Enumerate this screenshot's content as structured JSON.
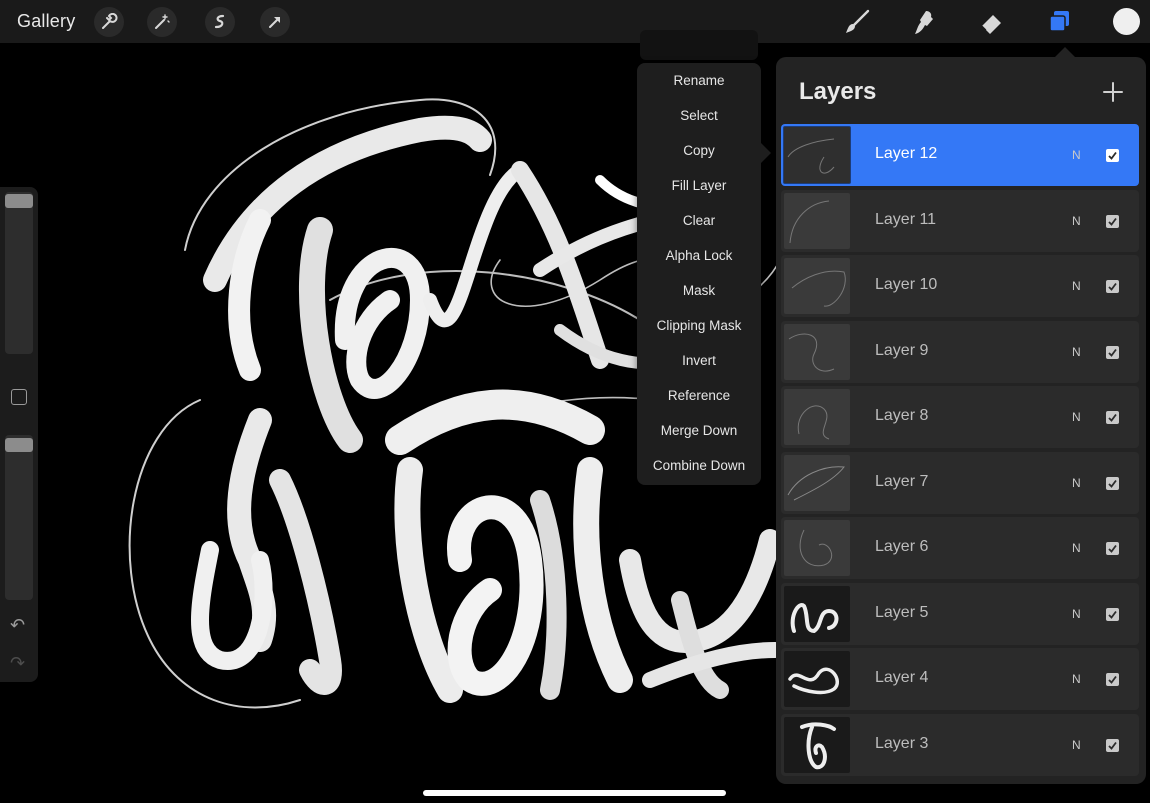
{
  "topbar": {
    "gallery_label": "Gallery",
    "left_tools": [
      "wrench-icon",
      "magic-wand-icon",
      "selection-icon",
      "transform-arrow-icon"
    ],
    "right_tools": [
      "brush-icon",
      "smudge-icon",
      "eraser-icon",
      "layers-icon"
    ],
    "active_tool": "layers-icon",
    "accent_color": "#3478f6",
    "current_color": "#efefef"
  },
  "sidebar": {
    "brush_size": 0.0,
    "opacity": 0.0,
    "undo_icon": "undo-icon",
    "redo_icon": "redo-icon"
  },
  "context_menu": {
    "items": [
      "Rename",
      "Select",
      "Copy",
      "Fill Layer",
      "Clear",
      "Alpha Lock",
      "Mask",
      "Clipping Mask",
      "Invert",
      "Reference",
      "Merge Down",
      "Combine Down"
    ]
  },
  "layers_panel": {
    "title": "Layers",
    "add_icon": "plus-icon",
    "layers": [
      {
        "name": "Layer 12",
        "blend": "N",
        "visible": true,
        "active": true
      },
      {
        "name": "Layer 11",
        "blend": "N",
        "visible": true,
        "active": false
      },
      {
        "name": "Layer 10",
        "blend": "N",
        "visible": true,
        "active": false
      },
      {
        "name": "Layer 9",
        "blend": "N",
        "visible": true,
        "active": false
      },
      {
        "name": "Layer 8",
        "blend": "N",
        "visible": true,
        "active": false
      },
      {
        "name": "Layer 7",
        "blend": "N",
        "visible": true,
        "active": false
      },
      {
        "name": "Layer 6",
        "blend": "N",
        "visible": true,
        "active": false
      },
      {
        "name": "Layer 5",
        "blend": "N",
        "visible": true,
        "active": false
      },
      {
        "name": "Layer 4",
        "blend": "N",
        "visible": true,
        "active": false
      },
      {
        "name": "Layer 3",
        "blend": "N",
        "visible": true,
        "active": false
      }
    ]
  }
}
